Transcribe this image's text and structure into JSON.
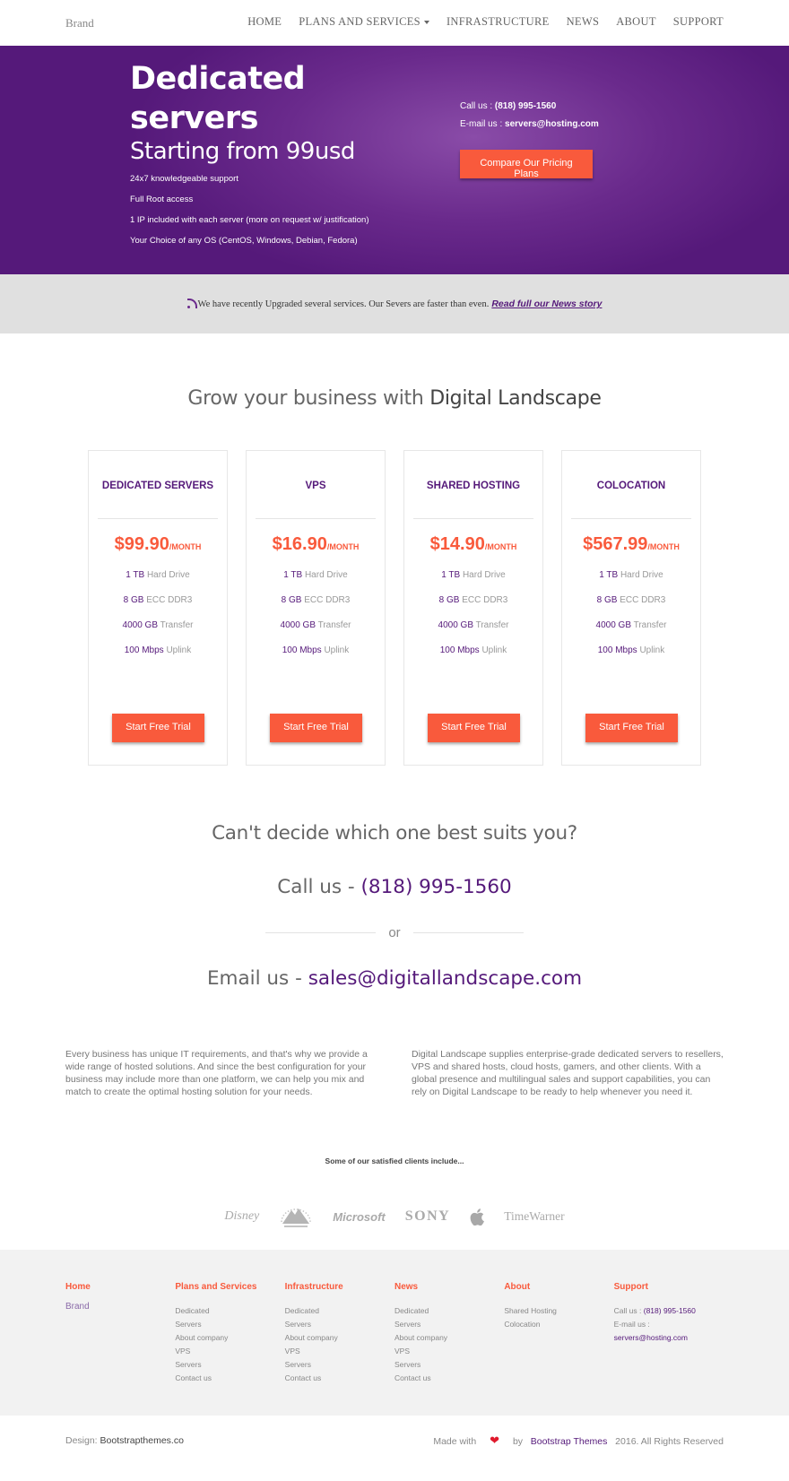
{
  "nav": {
    "brand": "Brand",
    "links": [
      "HOME",
      "PLANS AND SERVICES",
      "INFRASTRUCTURE",
      "NEWS",
      "ABOUT",
      "SUPPORT"
    ]
  },
  "hero": {
    "title": "Dedicated servers",
    "subtitle": "Starting from 99usd",
    "features": [
      "24x7 knowledgeable support",
      "Full Root access",
      "1 IP included with each server (more on request w/ justification)",
      "Your Choice of any OS (CentOS, Windows, Debian, Fedora)"
    ],
    "call_label": "Call us :",
    "call_value": "(818) 995-1560",
    "email_label": "E-mail us :",
    "email_value": "servers@hosting.com",
    "button": "Compare Our Pricing Plans"
  },
  "news": {
    "text": "We have recently Upgraded several services. Our Severs are faster than even.",
    "link": "Read full our News story"
  },
  "grow": {
    "prefix": "Grow your business with",
    "highlight": "Digital Landscape"
  },
  "plans": [
    {
      "title": "DEDICATED SERVERS",
      "price": "$99.90",
      "period": "/MONTH",
      "specs": [
        [
          "1 TB",
          "Hard Drive"
        ],
        [
          "8 GB",
          "ECC DDR3"
        ],
        [
          "4000 GB",
          "Transfer"
        ],
        [
          "100 Mbps",
          "Uplink"
        ]
      ],
      "button": "Start Free Trial"
    },
    {
      "title": "VPS",
      "price": "$16.90",
      "period": "/MONTH",
      "specs": [
        [
          "1 TB",
          "Hard Drive"
        ],
        [
          "8 GB",
          "ECC DDR3"
        ],
        [
          "4000 GB",
          "Transfer"
        ],
        [
          "100 Mbps",
          "Uplink"
        ]
      ],
      "button": "Start Free Trial"
    },
    {
      "title": "SHARED HOSTING",
      "price": "$14.90",
      "period": "/MONTH",
      "specs": [
        [
          "1 TB",
          "Hard Drive"
        ],
        [
          "8 GB",
          "ECC DDR3"
        ],
        [
          "4000 GB",
          "Transfer"
        ],
        [
          "100 Mbps",
          "Uplink"
        ]
      ],
      "button": "Start Free Trial"
    },
    {
      "title": "COLOCATION",
      "price": "$567.99",
      "period": "/MONTH",
      "specs": [
        [
          "1 TB",
          "Hard Drive"
        ],
        [
          "8 GB",
          "ECC DDR3"
        ],
        [
          "4000 GB",
          "Transfer"
        ],
        [
          "100 Mbps",
          "Uplink"
        ]
      ],
      "button": "Start Free Trial"
    }
  ],
  "contact": {
    "question": "Can't decide which one best suits you?",
    "call_prefix": "Call us -",
    "phone": "(818) 995-1560",
    "or": "or",
    "email_prefix": "Email us -",
    "email": "sales@digitallandscape.com"
  },
  "about": {
    "left": "Every business has unique IT requirements, and that's why we provide a wide range of hosted solutions. And since the best configuration for your business may include more than one platform, we can help you mix and match to create the optimal hosting solution for your needs.",
    "right": "Digital Landscape supplies enterprise-grade dedicated servers to resellers, VPS and shared hosts, cloud hosts, gamers, and other clients. With a global presence and multilingual sales and support capabilities, you can rely on Digital Landscape to be ready to help whenever you need it."
  },
  "clients": {
    "title": "Some of our satisfied clients include...",
    "logos": [
      "Disney",
      "Paramount",
      "Microsoft",
      "SONY",
      "Apple",
      "TimeWarner"
    ]
  },
  "footer": {
    "home": {
      "title": "Home",
      "brand": "Brand"
    },
    "plans": {
      "title": "Plans and Services",
      "items": [
        "Dedicated",
        "Servers",
        "About company",
        "VPS",
        "Servers",
        "Contact us"
      ]
    },
    "infrastructure": {
      "title": "Infrastructure",
      "items": [
        "Dedicated",
        "Servers",
        "About company",
        "VPS",
        "Servers",
        "Contact us"
      ]
    },
    "news": {
      "title": "News",
      "items": [
        "Dedicated",
        "Servers",
        "About company",
        "VPS",
        "Servers",
        "Contact us"
      ]
    },
    "about": {
      "title": "About",
      "items": [
        "Shared Hosting",
        "Colocation"
      ]
    },
    "support": {
      "title": "Support",
      "call_label": "Call us :",
      "phone": "(818) 995-1560",
      "email_label": "E-mail us :",
      "email": "servers@hosting.com"
    }
  },
  "bottom": {
    "design_label": "Design:",
    "design_value": "Bootstrapthemes.co",
    "made_with": "Made with",
    "by": "by",
    "by_value": "Bootstrap Themes",
    "copyright": "2016. All Rights Reserved"
  },
  "colors": {
    "accent": "#f95a3c",
    "brand_purple": "#55197a",
    "hero_purple": "#6a2a8c"
  }
}
